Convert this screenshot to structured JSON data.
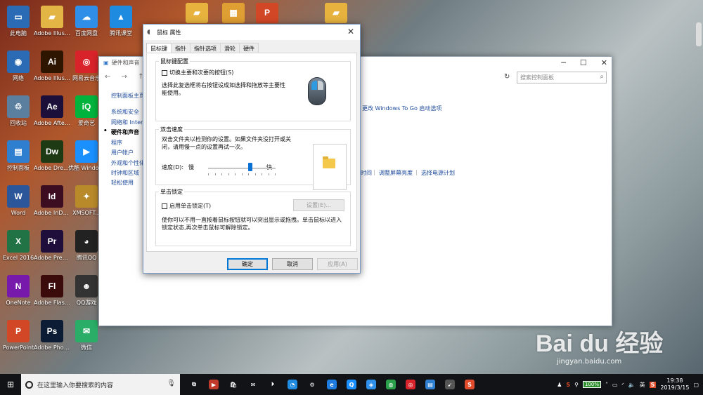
{
  "desktop": {
    "icons": [
      {
        "label": "此电脑",
        "glyph": "▭",
        "color": "#2b6bb5"
      },
      {
        "label": "网络",
        "glyph": "◉",
        "color": "#2b6bb5"
      },
      {
        "label": "回收站",
        "glyph": "♲",
        "color": "#5a7f9f"
      },
      {
        "label": "控制面板",
        "glyph": "▤",
        "color": "#2f7fd1"
      },
      {
        "label": "Word",
        "glyph": "W",
        "color": "#2b579a"
      },
      {
        "label": "Excel 2016",
        "glyph": "X",
        "color": "#217346"
      },
      {
        "label": "OneNote",
        "glyph": "N",
        "color": "#7719aa"
      },
      {
        "label": "PowerPoint",
        "glyph": "P",
        "color": "#d24726"
      },
      {
        "label": "Adobe Illustrat...",
        "glyph": "▰",
        "color": "#e2b545"
      },
      {
        "label": "Adobe Illustrat...",
        "glyph": "Ai",
        "color": "#2d1500"
      },
      {
        "label": "Adobe After Effects CS6",
        "glyph": "Ae",
        "color": "#1c0f3a"
      },
      {
        "label": "Adobe Dreamwe...",
        "glyph": "Dw",
        "color": "#1d3a14"
      },
      {
        "label": "Adobe InDesi...",
        "glyph": "Id",
        "color": "#3c0c21"
      },
      {
        "label": "Adobe Premie...",
        "glyph": "Pr",
        "color": "#1f0e3c"
      },
      {
        "label": "Adobe Flash Professio...",
        "glyph": "Fl",
        "color": "#3b0b0b"
      },
      {
        "label": "Adobe Photosh...",
        "glyph": "Ps",
        "color": "#0d1c35"
      },
      {
        "label": "百度网盘",
        "glyph": "☁",
        "color": "#2e8ee8"
      },
      {
        "label": "网易云音乐",
        "glyph": "◎",
        "color": "#d8232a"
      },
      {
        "label": "爱奇艺",
        "glyph": "iQ",
        "color": "#00b33c"
      },
      {
        "label": "优酷 Windows...",
        "glyph": "▶",
        "color": "#1a90ff"
      },
      {
        "label": "XMSOFT...",
        "glyph": "✦",
        "color": "#b88a2a"
      },
      {
        "label": "腾讯QQ",
        "glyph": "◕",
        "color": "#222"
      },
      {
        "label": "QQ游戏",
        "glyph": "☻",
        "color": "#333"
      },
      {
        "label": "微信",
        "glyph": "✉",
        "color": "#2aae67"
      },
      {
        "label": "腾讯课堂",
        "glyph": "▲",
        "color": "#1e8ae0"
      }
    ],
    "top_row": [
      {
        "glyph": "▰",
        "color": "#e7b33e"
      },
      {
        "glyph": "▦",
        "color": "#e09f33"
      },
      {
        "glyph": "P",
        "color": "#d24726"
      },
      {
        "glyph": "▰",
        "color": "#e7b33e"
      }
    ]
  },
  "control_panel": {
    "title": "硬件和声音",
    "nav": "← → ↑",
    "search_placeholder": "搜索控制面板",
    "sidebar": [
      {
        "label": "控制面板主页",
        "active": false
      },
      {
        "label": "系统和安全",
        "active": false
      },
      {
        "label": "网络和 Inter",
        "active": false
      },
      {
        "label": "硬件和声音",
        "active": true
      },
      {
        "label": "程序",
        "active": false
      },
      {
        "label": "用户帐户",
        "active": false
      },
      {
        "label": "外观和个性化",
        "active": false
      },
      {
        "label": "时钟和区域",
        "active": false
      },
      {
        "label": "轻松使用",
        "active": false
      }
    ],
    "link_wtg": "更改 Windows To Go 启动选项",
    "link_time": "时间",
    "link_brightness": "调整屏幕亮度",
    "link_power": "选择电源计划",
    "separator": "|"
  },
  "dialog": {
    "title": "鼠标 属性",
    "close": "✕",
    "tabs": [
      "鼠标键",
      "指针",
      "指针选项",
      "滑轮",
      "硬件"
    ],
    "active_tab": 0,
    "buttons_config": {
      "group": "鼠标键配置",
      "checkbox": "切换主要和次要的按钮(S)",
      "desc1": "选择此复选框将右按钮设成如选择和拖放等主要性",
      "desc2": "能使用。"
    },
    "double_click": {
      "group": "双击速度",
      "desc1": "双击文件夹以检测你的设置。如果文件夹没打开或关",
      "desc2": "闭，请用慢一点的设置再试一次。",
      "speed_label": "速度(D):",
      "slow": "慢",
      "fast": "快",
      "speed_fraction": 0.5
    },
    "click_lock": {
      "group": "单击锁定",
      "checkbox": "启用单击锁定(T)",
      "settings_button": "设置(E)...",
      "desc1": "使你可以不用一直按着鼠标按钮就可以突出显示或拖拽。单击鼠标以进入",
      "desc2": "锁定状态,再次单击鼠标可解除锁定。"
    },
    "ok": "确定",
    "cancel": "取消",
    "apply": "应用(A)"
  },
  "taskbar": {
    "search_placeholder": "在这里输入你要搜索的内容",
    "apps": [
      {
        "glyph": "⧉",
        "color": "#121316"
      },
      {
        "glyph": "▶",
        "color": "#c1392b"
      },
      {
        "glyph": "🛍",
        "color": "#121316"
      },
      {
        "glyph": "✉",
        "color": "#121316"
      },
      {
        "glyph": "⏵",
        "color": "#121316"
      },
      {
        "glyph": "◔",
        "color": "#1e8ae0"
      },
      {
        "glyph": "⚙",
        "color": "#121316"
      },
      {
        "glyph": "e",
        "color": "#1e7be0"
      },
      {
        "glyph": "Q",
        "color": "#1a90ff"
      },
      {
        "glyph": "◈",
        "color": "#2e8ee8"
      },
      {
        "glyph": "◍",
        "color": "#2aa04a"
      },
      {
        "glyph": "◎",
        "color": "#d8232a"
      },
      {
        "glyph": "▤",
        "color": "#2f7fd1"
      },
      {
        "glyph": "➹",
        "color": "#555"
      },
      {
        "glyph": "S",
        "color": "#e04b2b"
      }
    ],
    "battery": "100%",
    "tray_s": "S",
    "time": "19:38",
    "date": "2019/3/15",
    "ime": "英"
  },
  "watermark": {
    "brand": "Bai du 经验",
    "url": "jingyan.baidu.com"
  }
}
